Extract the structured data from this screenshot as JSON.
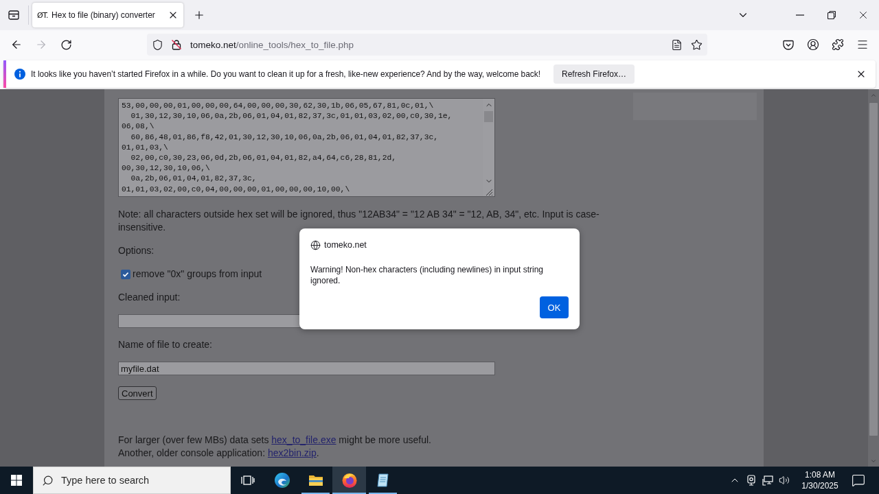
{
  "browser": {
    "tabs": [
      {
        "favicon": "ØT.",
        "title": "Hex to file (binary) converter",
        "selected": true
      }
    ],
    "forward_disabled": true,
    "address": {
      "host": "tomeko.net",
      "path": "/online_tools/hex_to_file.php"
    }
  },
  "notification": {
    "message": "It looks like you haven’t started Firefox in a while. Do you want to clean it up for a fresh, like-new experience? And by the way, welcome back!",
    "button": "Refresh Firefox…"
  },
  "page": {
    "hex_input": {
      "value": "53,00,00,00,01,00,00,00,64,00,00,00,30,62,30,1b,06,05,67,81,0c,01,\\\n  01,30,12,30,10,06,0a,2b,06,01,04,01,82,37,3c,01,01,03,02,00,c0,30,1e,\n06,08,\\\n  60,86,48,01,86,f8,42,01,30,12,30,10,06,0a,2b,06,01,04,01,82,37,3c,\n01,01,03,\\\n  02,00,c0,30,23,06,0d,2b,06,01,04,01,82,a4,64,c6,28,81,2d,\n00,30,12,30,10,06,\\\n  0a,2b,06,01,04,01,82,37,3c,\n01,01,03,02,00,c0,04,00,00,00,01,00,00,00,10,00,\\"
    },
    "note": "Note: all characters outside hex set will be ignored, thus \"12AB34\" = \"12 AB 34\" = \"12, AB, 34\", etc. Input is case-insensitive.",
    "options_label": "Options:",
    "option": {
      "label": "remove \"0x\" groups from input",
      "checked": true
    },
    "cleaned_label": "Cleaned input:",
    "filename_label": "Name of file to create:",
    "filename_input": {
      "value": "myfile.dat"
    },
    "convert_button": "Convert",
    "footer": [
      {
        "before": "For larger (over few MBs) data sets ",
        "link": "hex_to_file.exe",
        "after": " might be more useful."
      },
      {
        "before": "Another, older console application: ",
        "link": "hex2bin.zip",
        "after": "."
      }
    ]
  },
  "dialog": {
    "origin": "tomeko.net",
    "message": "Warning! Non-hex characters (including newlines) in input string ignored.",
    "button": "OK"
  },
  "taskbar": {
    "search_placeholder": "Type here to search",
    "apps": [
      {
        "kind": "edge",
        "running": false,
        "selected": false
      },
      {
        "kind": "explorer",
        "running": true,
        "selected": false
      },
      {
        "kind": "firefox",
        "running": true,
        "selected": true
      },
      {
        "kind": "notepad",
        "running": true,
        "selected": false
      }
    ],
    "time": "1:08 AM",
    "date": "1/30/2025"
  }
}
